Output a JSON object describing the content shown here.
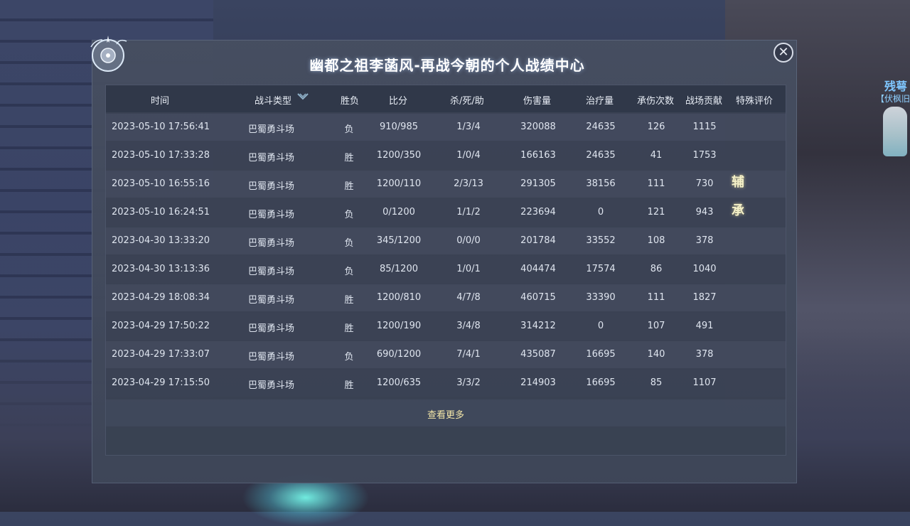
{
  "panel": {
    "title": "幽都之祖李菡风-再战今朝的个人战绩中心",
    "more_label": "查看更多"
  },
  "npc": {
    "name": "残萼",
    "guild": "【伏枫旧|"
  },
  "icons": {
    "close": "close-icon",
    "chevron": "chevron-down-icon",
    "compass": "compass-ornament-icon"
  },
  "colors": {
    "accent_text": "#f3e6a8",
    "badge_text": "#f4f0c8"
  },
  "table": {
    "headers": [
      "时间",
      "战斗类型",
      "胜负",
      "比分",
      "杀/死/助",
      "伤害量",
      "治疗量",
      "承伤次数",
      "战场贡献",
      "特殊评价"
    ],
    "rows": [
      [
        "2023-05-10 17:56:41",
        "巴蜀勇斗场",
        "负",
        "910/985",
        "1/3/4",
        "320088",
        "24635",
        "126",
        "1115",
        ""
      ],
      [
        "2023-05-10 17:33:28",
        "巴蜀勇斗场",
        "胜",
        "1200/350",
        "1/0/4",
        "166163",
        "24635",
        "41",
        "1753",
        ""
      ],
      [
        "2023-05-10 16:55:16",
        "巴蜀勇斗场",
        "胜",
        "1200/110",
        "2/3/13",
        "291305",
        "38156",
        "111",
        "730",
        "辅"
      ],
      [
        "2023-05-10 16:24:51",
        "巴蜀勇斗场",
        "负",
        "0/1200",
        "1/1/2",
        "223694",
        "0",
        "121",
        "943",
        "承"
      ],
      [
        "2023-04-30 13:33:20",
        "巴蜀勇斗场",
        "负",
        "345/1200",
        "0/0/0",
        "201784",
        "33552",
        "108",
        "378",
        ""
      ],
      [
        "2023-04-30 13:13:36",
        "巴蜀勇斗场",
        "负",
        "85/1200",
        "1/0/1",
        "404474",
        "17574",
        "86",
        "1040",
        ""
      ],
      [
        "2023-04-29 18:08:34",
        "巴蜀勇斗场",
        "胜",
        "1200/810",
        "4/7/8",
        "460715",
        "33390",
        "111",
        "1827",
        ""
      ],
      [
        "2023-04-29 17:50:22",
        "巴蜀勇斗场",
        "胜",
        "1200/190",
        "3/4/8",
        "314212",
        "0",
        "107",
        "491",
        ""
      ],
      [
        "2023-04-29 17:33:07",
        "巴蜀勇斗场",
        "负",
        "690/1200",
        "7/4/1",
        "435087",
        "16695",
        "140",
        "378",
        ""
      ],
      [
        "2023-04-29 17:15:50",
        "巴蜀勇斗场",
        "胜",
        "1200/635",
        "3/3/2",
        "214903",
        "16695",
        "85",
        "1107",
        ""
      ]
    ]
  }
}
